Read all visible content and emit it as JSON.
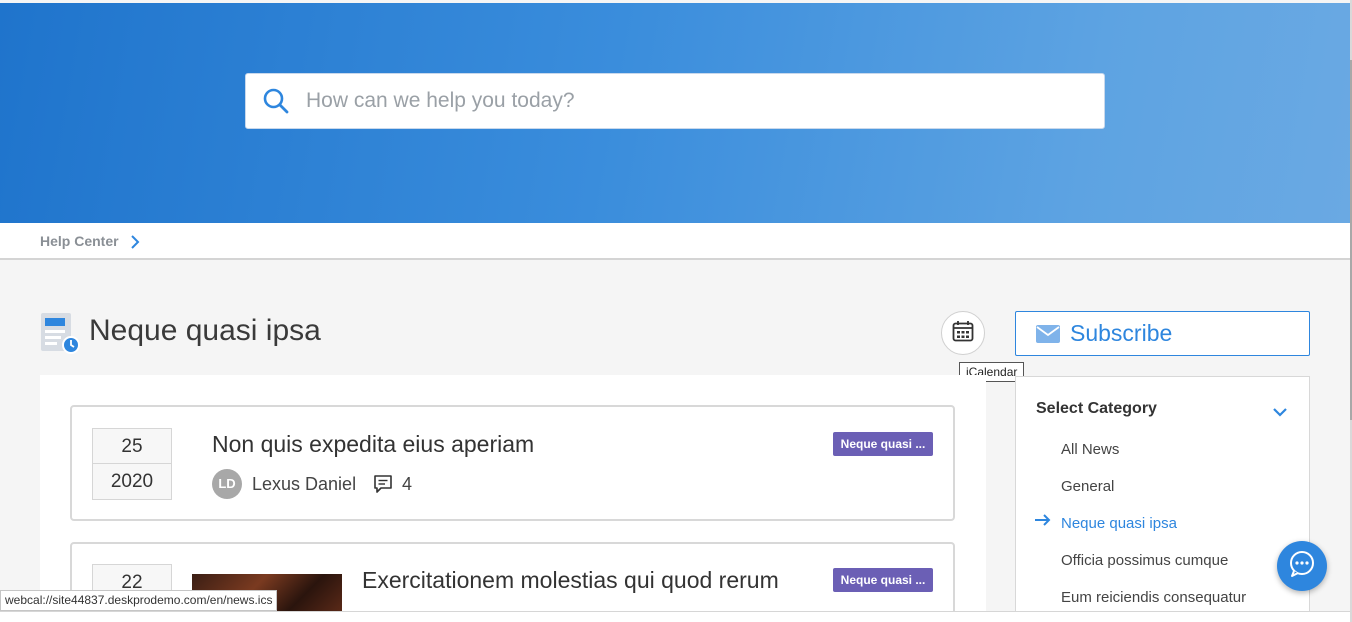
{
  "search": {
    "placeholder": "How can we help you today?"
  },
  "breadcrumb": {
    "label": "Help Center"
  },
  "page": {
    "title": "Neque quasi ipsa"
  },
  "calendar": {
    "tooltip": "iCalendar"
  },
  "subscribe": {
    "label": "Subscribe"
  },
  "articles": [
    {
      "day": "25",
      "year": "2020",
      "title": "Non quis expedita eius aperiam",
      "tag": "Neque quasi ...",
      "author_initials": "LD",
      "author": "Lexus Daniel",
      "comments": "4"
    },
    {
      "day": "22",
      "title": "Exercitationem molestias qui quod rerum",
      "tag": "Neque quasi ..."
    }
  ],
  "categories": {
    "heading": "Select Category",
    "items": [
      "All News",
      "General",
      "Neque quasi ipsa",
      "Officia possimus cumque",
      "Eum reiciendis consequatur"
    ],
    "active_index": 2
  },
  "status_bar": {
    "url": "webcal://site44837.deskprodemo.com/en/news.ics"
  },
  "colors": {
    "accent": "#2e86de",
    "tag": "#6b5fb5",
    "hero_start": "#1f74cc",
    "hero_end": "#6aa9e3"
  }
}
